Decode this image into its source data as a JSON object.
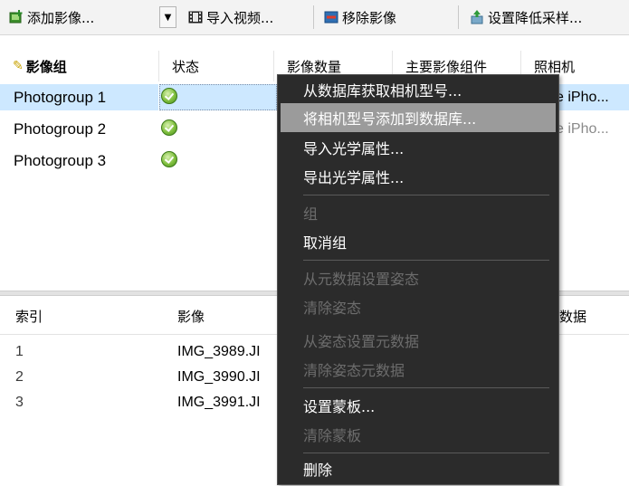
{
  "toolbar": {
    "add_images": "添加影像...",
    "import_video": "导入视频...",
    "remove_images": "移除影像",
    "set_downsampling": "设置降低采样..."
  },
  "photogroups_table": {
    "headers": [
      "影像组",
      "状态",
      "影像数量",
      "主要影像组件",
      "照相机"
    ],
    "rows": [
      {
        "name": "Photogroup 1",
        "camera": "e iPho..."
      },
      {
        "name": "Photogroup 2",
        "camera": "e iPho..."
      },
      {
        "name": "Photogroup 3",
        "camera": ""
      }
    ]
  },
  "images_table": {
    "headers": [
      "索引",
      "影像",
      "数据"
    ],
    "rows": [
      {
        "index": "1",
        "image": "IMG_3989.JI"
      },
      {
        "index": "2",
        "image": "IMG_3990.JI"
      },
      {
        "index": "3",
        "image": "IMG_3991.JI"
      }
    ]
  },
  "context_menu": {
    "items": [
      {
        "label": "从数据库获取相机型号...",
        "enabled": true
      },
      {
        "label": "将相机型号添加到数据库...",
        "enabled": true,
        "highlighted": true
      },
      {
        "label": "导入光学属性...",
        "enabled": true
      },
      {
        "label": "导出光学属性...",
        "enabled": true
      },
      {
        "label": "组",
        "enabled": false
      },
      {
        "label": "取消组",
        "enabled": true
      },
      {
        "label": "从元数据设置姿态",
        "enabled": false
      },
      {
        "label": "清除姿态",
        "enabled": false
      },
      {
        "label": "从姿态设置元数据",
        "enabled": false
      },
      {
        "label": "清除姿态元数据",
        "enabled": false
      },
      {
        "label": "设置蒙板...",
        "enabled": true
      },
      {
        "label": "清除蒙板",
        "enabled": false
      },
      {
        "label": "删除",
        "enabled": true
      }
    ]
  },
  "colors": {
    "selection": "#cde8ff",
    "menu_bg": "#2b2b2b",
    "menu_highlight": "#9b9b9b",
    "menu_disabled_text": "#6d6d6d"
  }
}
